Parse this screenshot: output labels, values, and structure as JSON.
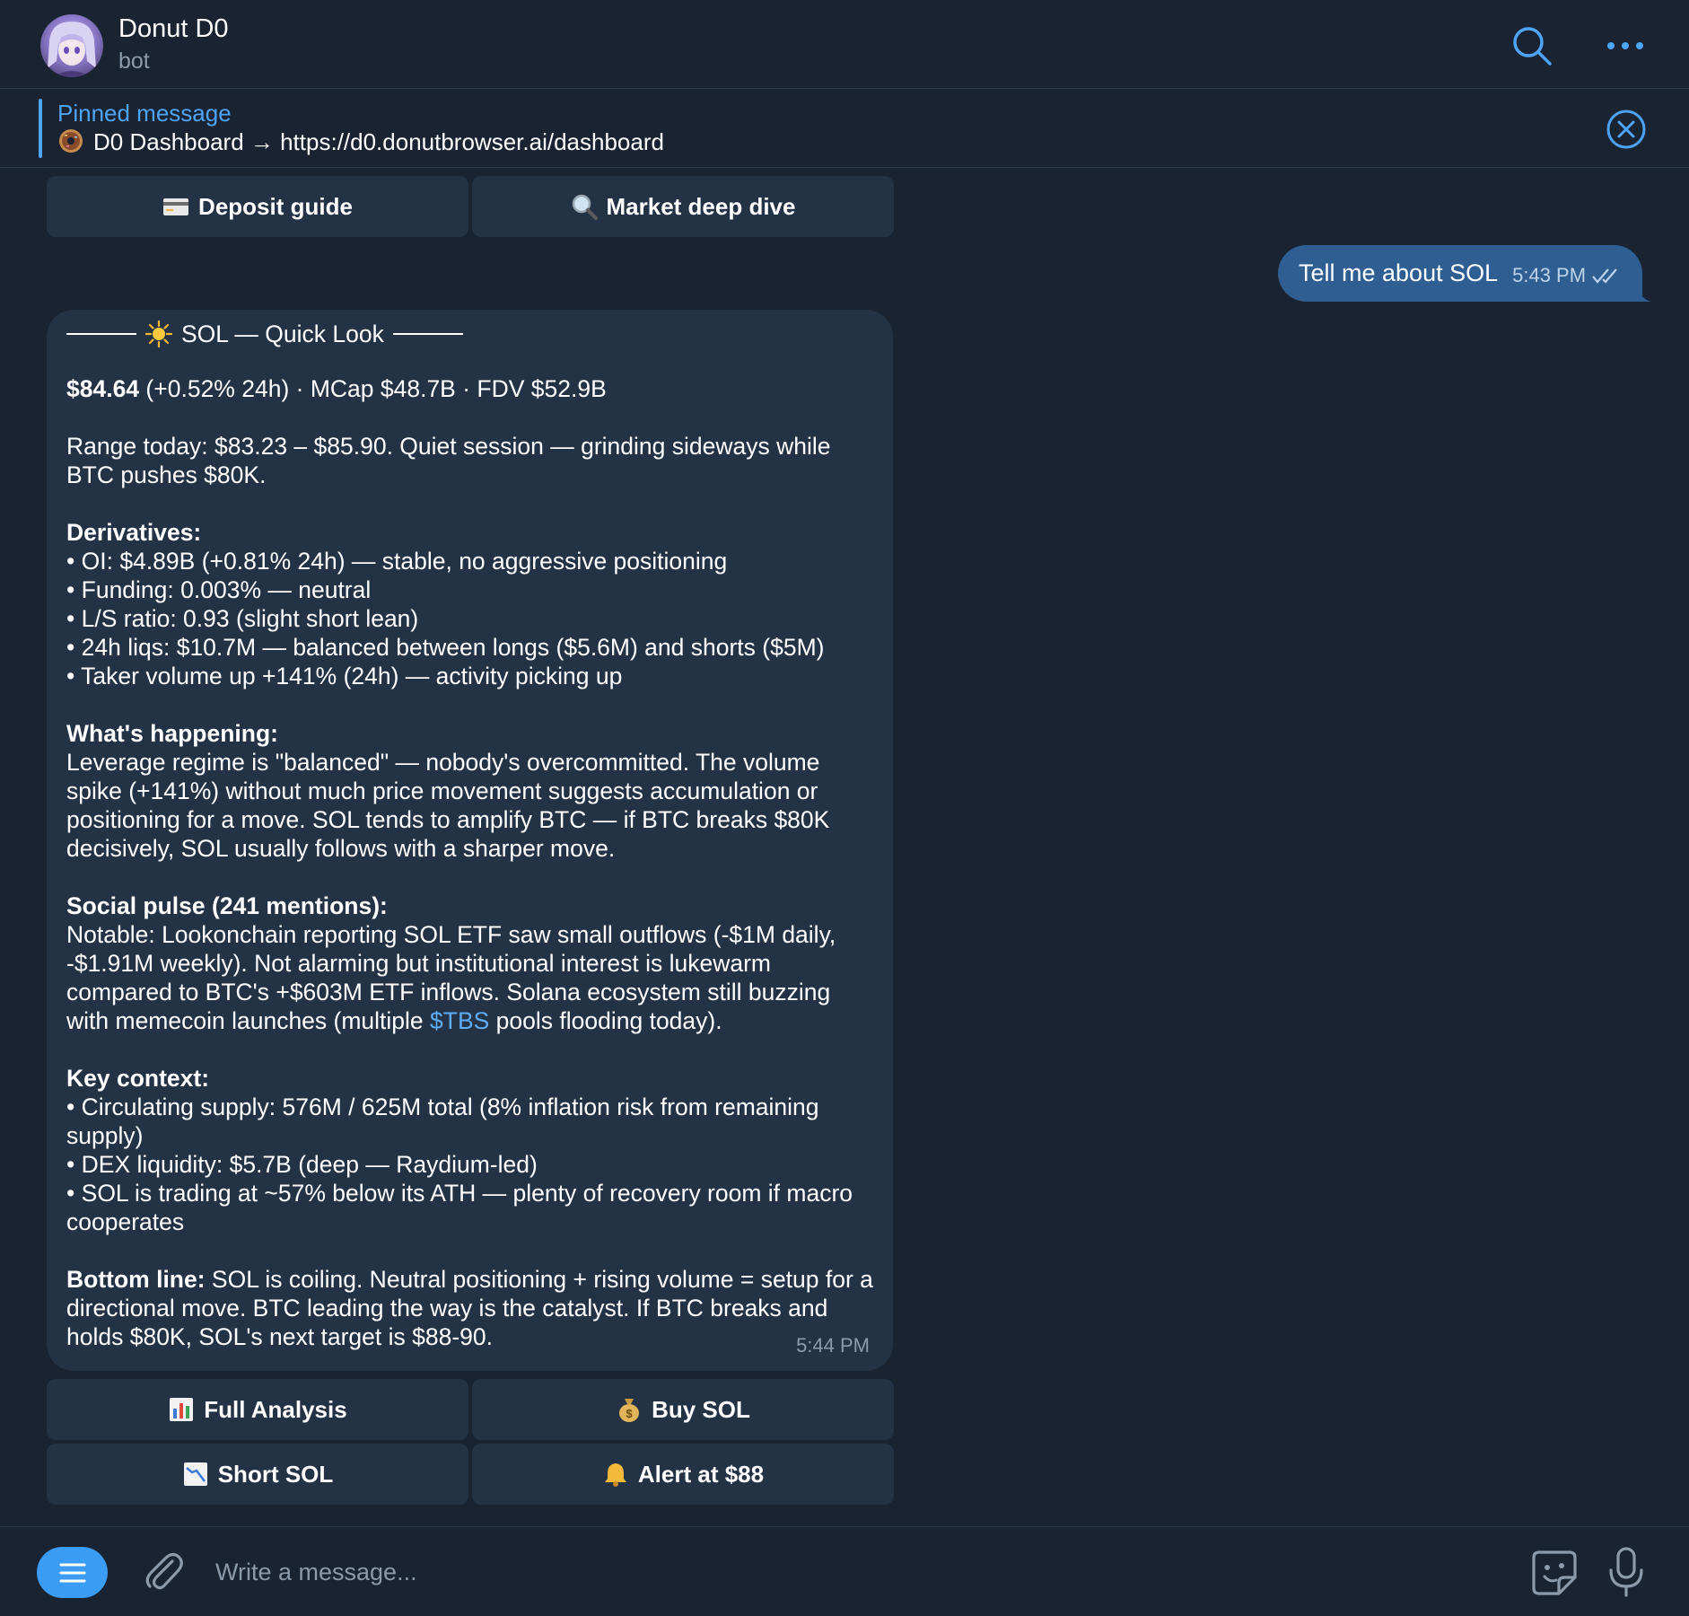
{
  "header": {
    "title": "Donut D0",
    "subtitle": "bot",
    "avatar_icon": "anime-avatar-icon",
    "search_icon": "search-icon",
    "more_icon": "more-icon"
  },
  "pinned": {
    "title": "Pinned message",
    "text": "D0 Dashboard → https://d0.donutbrowser.ai/dashboard",
    "icon": "donut-icon",
    "close_icon": "close-circle-icon"
  },
  "top_buttons": [
    {
      "label": "Deposit guide",
      "icon": "credit-card-icon"
    },
    {
      "label": "Market deep dive",
      "icon": "magnifier-icon"
    }
  ],
  "outgoing": {
    "text": "Tell me about SOL",
    "time": "5:43 PM"
  },
  "incoming": {
    "heading": "SOL — Quick Look",
    "price": "$84.64",
    "price_rest": " (+0.52% 24h) · MCap $48.7B · FDV $52.9B",
    "range": "Range today: $83.23 – $85.90. Quiet session — grinding sideways while BTC pushes $80K.",
    "derivatives_title": "Derivatives:",
    "derivatives": [
      "• OI: $4.89B (+0.81% 24h) — stable, no aggressive positioning",
      "• Funding: 0.003% — neutral",
      "• L/S ratio: 0.93 (slight short lean)",
      "• 24h liqs: $10.7M — balanced between longs ($5.6M) and shorts ($5M)",
      "• Taker volume up +141% (24h) — activity picking up"
    ],
    "happening_title": "What's happening:",
    "happening_text": "Leverage regime is \"balanced\" — nobody's overcommitted. The volume spike (+141%) without much price movement suggests accumulation or positioning for a move. SOL tends to amplify BTC — if BTC breaks $80K decisively, SOL usually follows with a sharper move.",
    "social_title": "Social pulse (241 mentions):",
    "social_text_before": "Notable: Lookonchain reporting SOL ETF saw small outflows (-$1M daily, -$1.91M weekly). Not alarming but institutional interest is lukewarm compared to BTC's +$603M ETF inflows. Solana ecosystem still buzzing with memecoin launches (multiple ",
    "social_link": "$TBS",
    "social_text_after": " pools flooding today).",
    "context_title": "Key context:",
    "context": [
      "• Circulating supply: 576M / 625M total (8% inflation risk from remaining supply)",
      "• DEX liquidity: $5.7B (deep — Raydium-led)",
      "• SOL is trading at ~57% below its ATH — plenty of recovery room if macro cooperates"
    ],
    "bottom_title": "Bottom line:",
    "bottom_text": " SOL is coiling. Neutral positioning + rising volume = setup for a directional move. BTC leading the way is the catalyst. If BTC breaks and holds $80K, SOL's next target is $88-90.",
    "time": "5:44 PM",
    "heading_icon": "sun-icon"
  },
  "action_buttons": [
    {
      "label": "Full Analysis",
      "icon": "bar-chart-icon"
    },
    {
      "label": "Buy SOL",
      "icon": "money-bag-icon"
    },
    {
      "label": "Short SOL",
      "icon": "chart-down-icon"
    },
    {
      "label": "Alert at $88",
      "icon": "bell-icon"
    }
  ],
  "composer": {
    "placeholder": "Write a message...",
    "menu_icon": "menu-icon",
    "attach_icon": "paperclip-icon",
    "sticker_icon": "sticker-icon",
    "mic_icon": "microphone-icon"
  },
  "colors": {
    "background": "#192332",
    "bubble_in": "#243246",
    "bubble_out": "#2f5f92",
    "accent": "#4ea4f6",
    "muted": "#8c9aab"
  }
}
